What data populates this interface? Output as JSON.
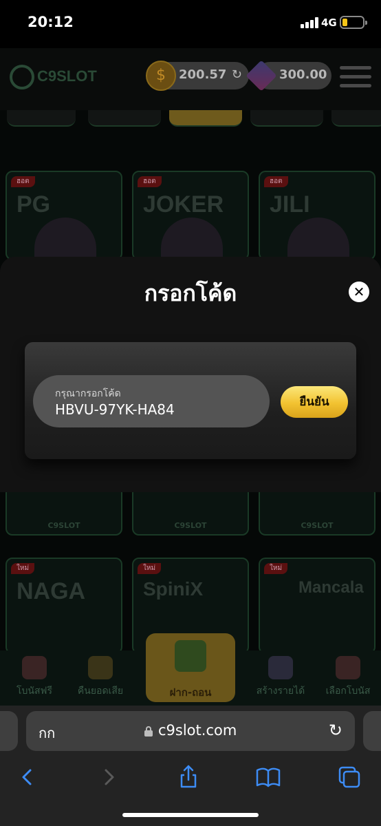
{
  "status_bar": {
    "time": "20:12",
    "network": "4G",
    "battery_percent": 25
  },
  "header": {
    "logo_text": "C9SLOT",
    "balance": "200.57",
    "points": "300.00"
  },
  "game_tiles": [
    {
      "badge": "ฮอต",
      "brand": "PG",
      "footer": ""
    },
    {
      "badge": "ฮอต",
      "brand": "JOKER",
      "footer": ""
    },
    {
      "badge": "ฮอต",
      "brand": "JILI",
      "footer": ""
    },
    {
      "badge": "",
      "brand": "",
      "footer": "C9SLOT"
    },
    {
      "badge": "",
      "brand": "",
      "footer": "C9SLOT"
    },
    {
      "badge": "",
      "brand": "",
      "footer": "C9SLOT"
    },
    {
      "badge": "ใหม่",
      "brand": "NAGA",
      "footer": ""
    },
    {
      "badge": "ใหม่",
      "brand": "SpiniX",
      "footer": ""
    },
    {
      "badge": "ใหม่",
      "brand": "Mancala",
      "footer": ""
    }
  ],
  "bottom_nav": {
    "items": [
      {
        "label": "โบนัสฟรี",
        "icon": "gift-icon"
      },
      {
        "label": "คืนยอดเสีย",
        "icon": "cashback-icon"
      },
      {
        "label": "สร้างรายได้",
        "icon": "affiliate-icon"
      },
      {
        "label": "เลือกโบนัส",
        "icon": "megaphone-icon"
      }
    ],
    "center_label": "ฝาก-ถอน"
  },
  "modal": {
    "title": "กรอกโค้ด",
    "input_label": "กรุณากรอกโค้ด",
    "input_value": "HBVU-97YK-HA84",
    "confirm_label": "ยืนยัน",
    "close_icon": "close-icon"
  },
  "browser": {
    "aa_label": "กก",
    "url": "c9slot.com"
  },
  "colors": {
    "accent_gold": "#f2c230",
    "modal_bg": "#121212",
    "browser_bg": "#232323"
  }
}
